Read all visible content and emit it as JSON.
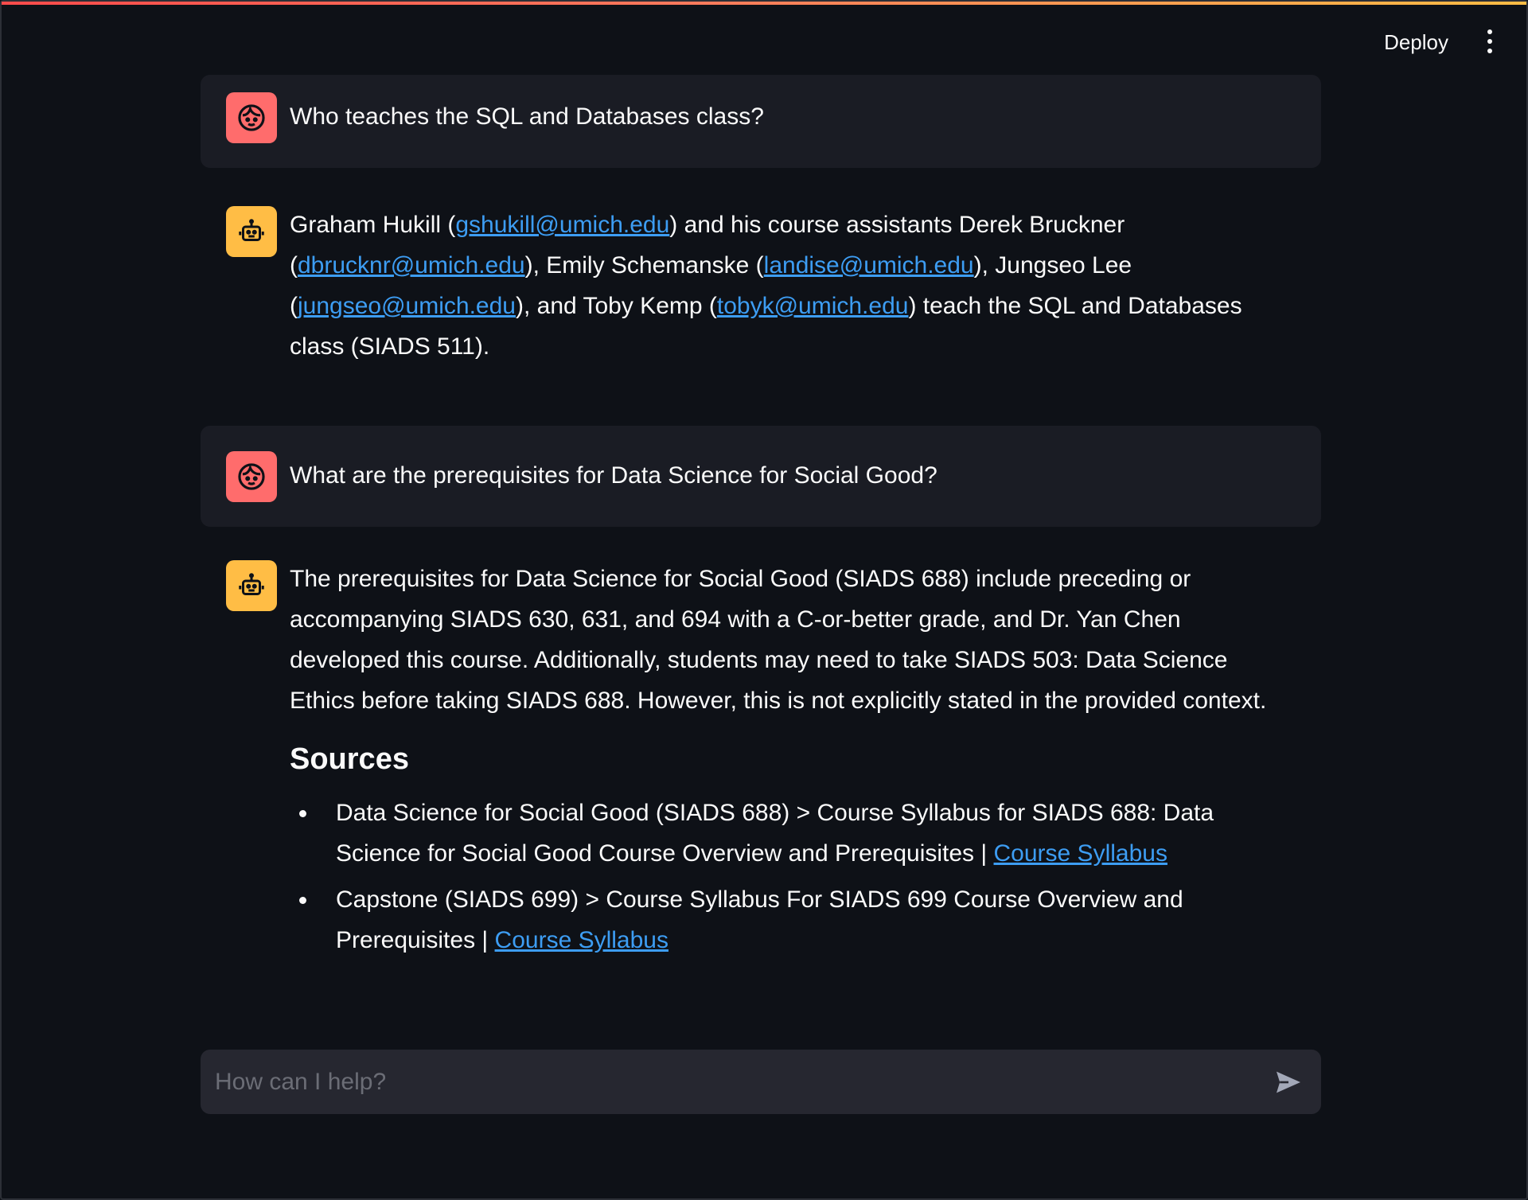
{
  "header": {
    "deploy_label": "Deploy",
    "menu_icon": "kebab-menu-icon"
  },
  "colors": {
    "accent_gradient": [
      "#ff4b4b",
      "#ffbd45"
    ],
    "user_avatar": "#ff6c6c",
    "bot_avatar": "#ffbd45",
    "link": "#3d9df3",
    "background": "#0e1117"
  },
  "messages": {
    "m1": {
      "role": "user",
      "avatar_icon": "user-face-icon",
      "text": "Who teaches the SQL and Databases class?"
    },
    "m2": {
      "role": "assistant",
      "avatar_icon": "robot-icon",
      "t1": "Graham Hukill (",
      "email1": "gshukill@umich.edu",
      "t2": ") and his course assistants Derek Bruckner (",
      "email2": "dbrucknr@umich.edu",
      "t3": "), Emily Schemanske (",
      "email3": "landise@umich.edu",
      "t4": "), Jungseo Lee (",
      "email4": "jungseo@umich.edu",
      "t5": "), and Toby Kemp (",
      "email5": "tobyk@umich.edu",
      "t6": ") teach the SQL and Databases class (SIADS 511)."
    },
    "m3": {
      "role": "user",
      "avatar_icon": "user-face-icon",
      "text": "What are the prerequisites for Data Science for Social Good?"
    },
    "m4": {
      "role": "assistant",
      "avatar_icon": "robot-icon",
      "text": "The prerequisites for Data Science for Social Good (SIADS 688) include preceding or accompanying SIADS 630, 631, and 694 with a C-or-better grade, and Dr. Yan Chen developed this course. Additionally, students may need to take SIADS 503: Data Science Ethics before taking SIADS 688. However, this is not explicitly stated in the provided context.",
      "sources_heading": "Sources",
      "sources": [
        {
          "text": "Data Science for Social Good (SIADS 688) > Course Syllabus for SIADS 688: Data Science for Social Good Course Overview and Prerequisites | ",
          "link": "Course Syllabus"
        },
        {
          "text": "Capstone (SIADS 699) > Course Syllabus For SIADS 699 Course Overview and Prerequisites | ",
          "link": "Course Syllabus"
        }
      ]
    }
  },
  "chat_input": {
    "placeholder": "How can I help?",
    "send_icon": "send-icon"
  }
}
